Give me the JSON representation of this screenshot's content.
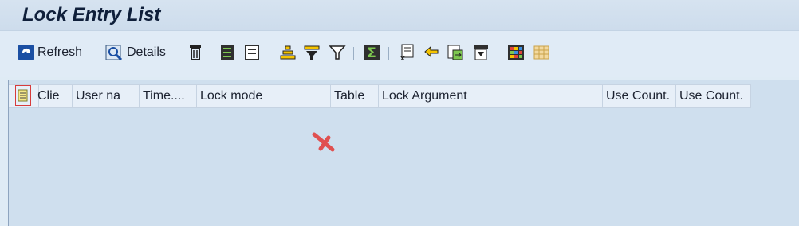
{
  "window": {
    "title": "Lock Entry List"
  },
  "toolbar": {
    "refresh_label": "Refresh",
    "details_label": "Details",
    "icons": [
      "refresh-icon",
      "details-icon",
      "delete-icon",
      "select-all-icon",
      "deselect-all-icon",
      "sort-ascending-icon",
      "filter-icon",
      "set-filter-icon",
      "sum-icon",
      "export-icon",
      "find-icon",
      "local-file-icon",
      "print-preview-icon",
      "change-layout-icon",
      "choose-layout-icon"
    ]
  },
  "table": {
    "columns": [
      {
        "label": "Clie",
        "truncated": true
      },
      {
        "label": "User na",
        "truncated": true
      },
      {
        "label": "Time....",
        "truncated": true
      },
      {
        "label": "Lock mode",
        "truncated": false
      },
      {
        "label": "Table",
        "truncated": false
      },
      {
        "label": "Lock Argument",
        "truncated": false
      },
      {
        "label": "Use Count.",
        "truncated": false
      },
      {
        "label": "Use Count.",
        "truncated": false
      }
    ],
    "rows": []
  },
  "colors": {
    "accent": "#1a5fb4",
    "marker": "#e05050"
  }
}
